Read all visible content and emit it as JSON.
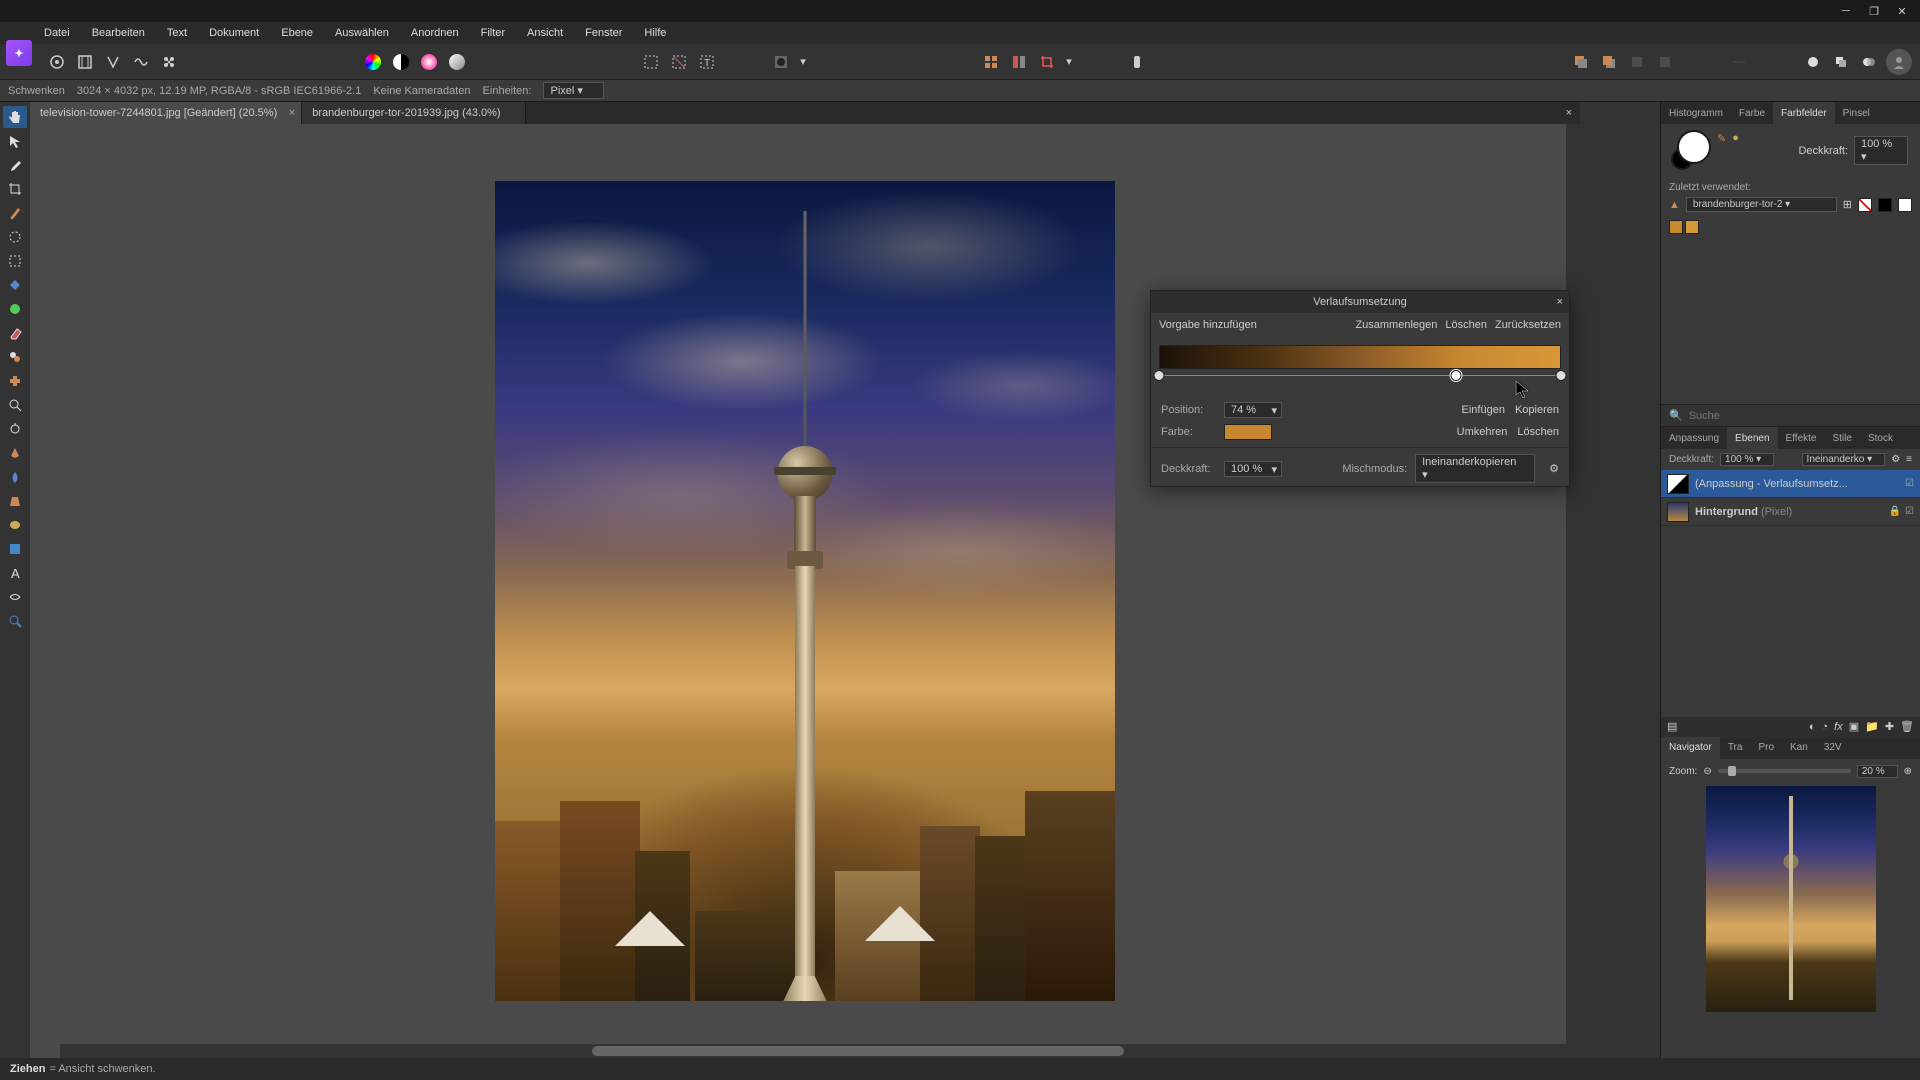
{
  "menus": [
    "Datei",
    "Bearbeiten",
    "Text",
    "Dokument",
    "Ebene",
    "Auswählen",
    "Anordnen",
    "Filter",
    "Ansicht",
    "Fenster",
    "Hilfe"
  ],
  "context": {
    "tool": "Schwenken",
    "docinfo": "3024 × 4032 px, 12.19 MP, RGBA/8 - sRGB IEC61966-2.1",
    "camera": "Keine Kameradaten",
    "units_label": "Einheiten:",
    "units_value": "Pixel"
  },
  "tabs": [
    {
      "label": "television-tower-7244801.jpg [Geändert] (20.5%)",
      "active": true
    },
    {
      "label": "brandenburger-tor-201939.jpg (43.0%)",
      "active": false
    }
  ],
  "dialog": {
    "title": "Verlaufsumsetzung",
    "add_preset": "Vorgabe hinzufügen",
    "merge": "Zusammenlegen",
    "delete": "Löschen",
    "reset": "Zurücksetzen",
    "position_label": "Position:",
    "position_value": "74 %",
    "color_label": "Farbe:",
    "insert": "Einfügen",
    "copy": "Kopieren",
    "invert": "Umkehren",
    "delete2": "Löschen",
    "opacity_label": "Deckkraft:",
    "opacity_value": "100 %",
    "blend_label": "Mischmodus:",
    "blend_value": "Ineinanderkopieren",
    "stops": [
      0,
      74,
      100
    ]
  },
  "right_tabs_top": [
    "Histogramm",
    "Farbe",
    "Farbfelder",
    "Pinsel"
  ],
  "color_panel": {
    "opacity_label": "Deckkraft:",
    "opacity_value": "100 %",
    "recent_label": "Zuletzt verwendet:",
    "recent_preset": "brandenburger-tor-2",
    "swatches": [
      "#c88830",
      "#d89838"
    ]
  },
  "search": {
    "placeholder": "Suche"
  },
  "right_tabs_mid": [
    "Anpassung",
    "Ebenen",
    "Effekte",
    "Stile",
    "Stock"
  ],
  "layers": {
    "opacity_label": "Deckkraft:",
    "opacity_value": "100 %",
    "blend_value": "Ineinanderko",
    "items": [
      {
        "name": "(Anpassung - Verlaufsumsetz...",
        "selected": true,
        "type": "adj"
      },
      {
        "name": "Hintergrund",
        "suffix": "(Pixel)",
        "selected": false,
        "type": "bg"
      }
    ]
  },
  "right_tabs_bot": [
    "Navigator",
    "Tra",
    "Pro",
    "Kan",
    "32V"
  ],
  "navigator": {
    "zoom_label": "Zoom:",
    "zoom_value": "20 %"
  },
  "status": {
    "action": "Ziehen",
    "desc": "= Ansicht schwenken."
  }
}
